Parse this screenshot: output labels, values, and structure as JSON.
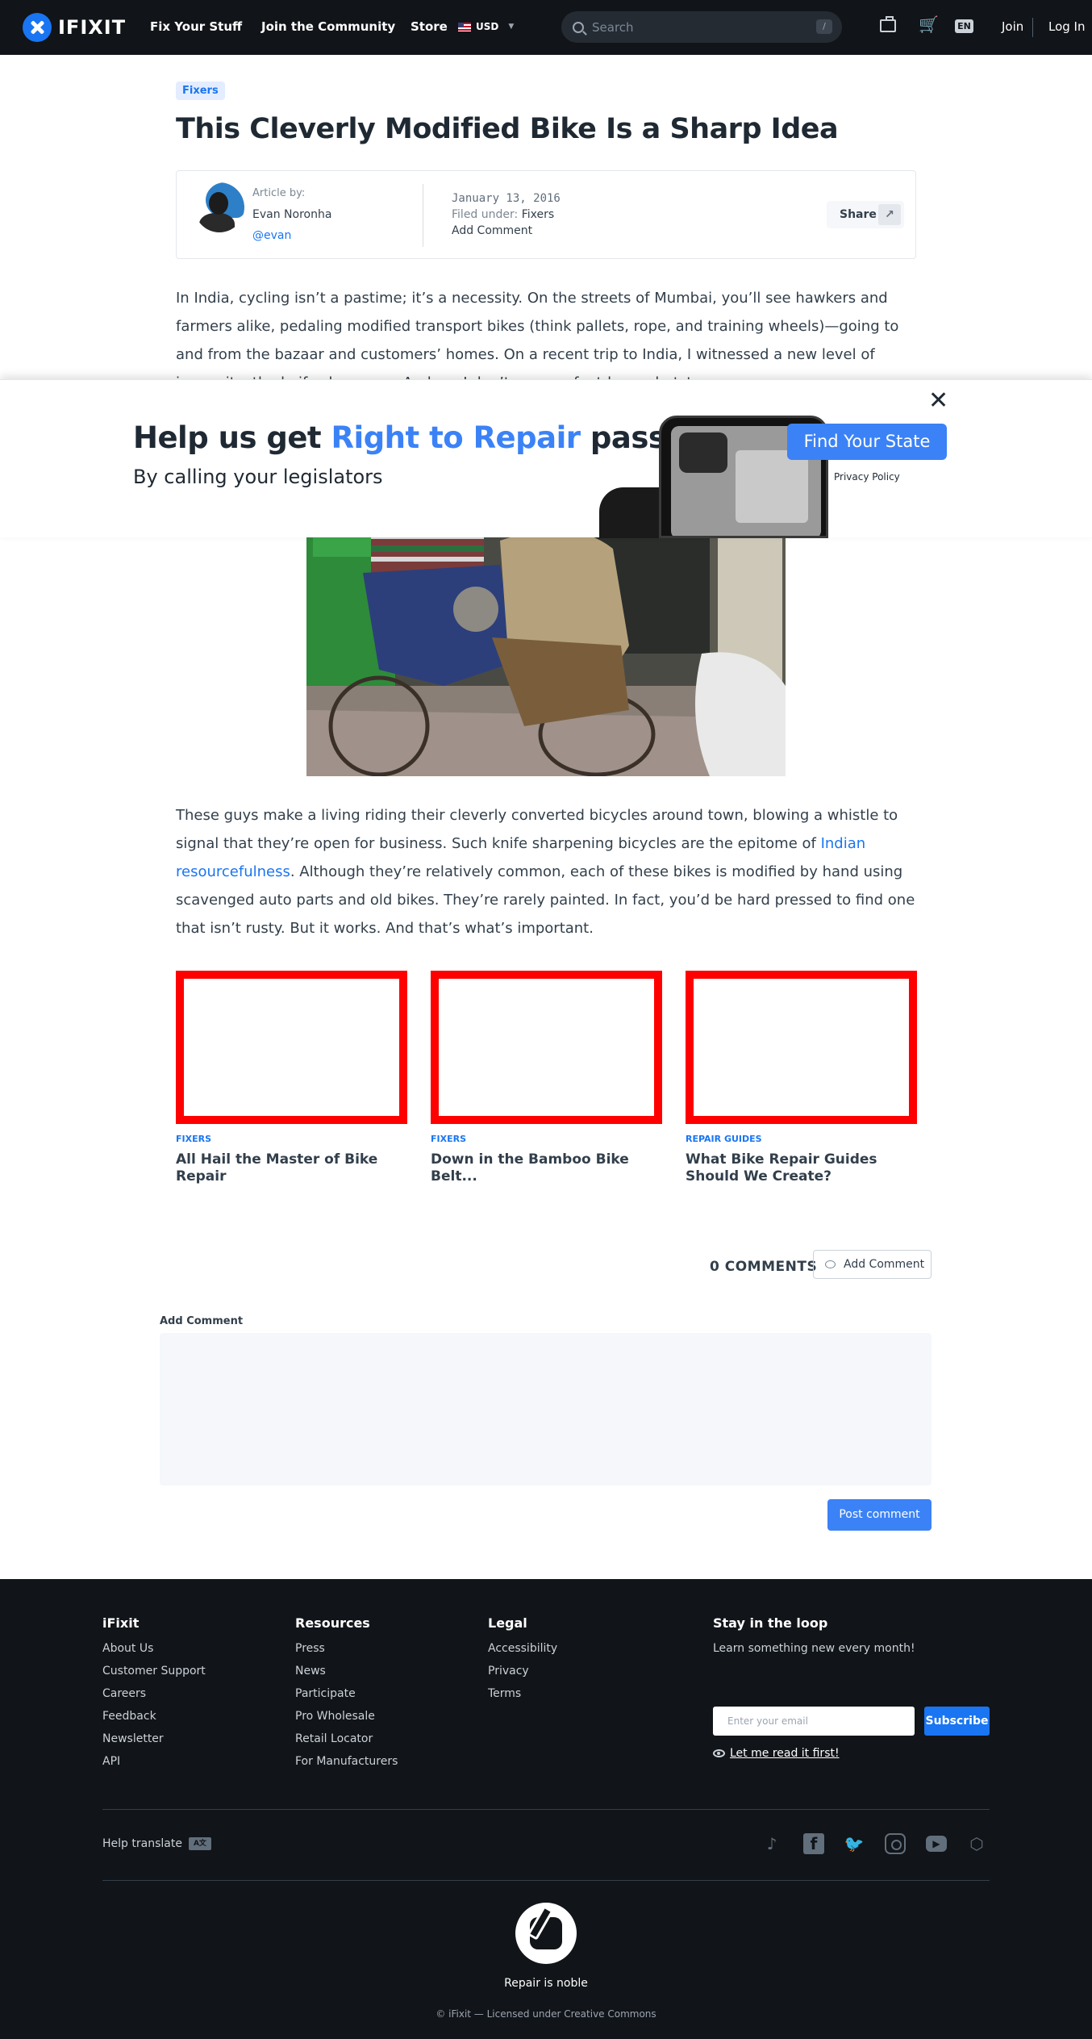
{
  "nav": {
    "logo": "IFIXIT",
    "links": [
      "Fix Your Stuff",
      "Join the Community",
      "Store"
    ],
    "currency": "USD",
    "search_placeholder": "Search",
    "search_shortcut": "/",
    "lang": "EN",
    "join": "Join",
    "login": "Log In"
  },
  "article": {
    "tag": "Fixers",
    "title": "This Cleverly Modified Bike Is a Sharp Idea",
    "article_by_label": "Article by:",
    "author": "Evan Noronha",
    "handle": "@evan",
    "date": "January 13, 2016",
    "filed_label": "Filed under:",
    "filed_value": "Fixers",
    "add_comment": "Add Comment",
    "share": "Share",
    "p1": "In India, cycling isn’t a pastime; it’s a necessity. On the streets of Mumbai, you’ll see hawkers and farmers alike, pedaling modified transport bikes (think pallets, rope, and training wheels)—going to and from the bazaar and customers’ homes. On a recent trip to India, I witnessed a new level of ingenuity: the knife sharpener. And no, I don’t mean a foot-long whetstone.",
    "p2_before": "These guys make a living riding their cleverly converted bicycles around town, blowing a whistle to signal that they’re open for business. Such knife sharpening bicycles are the epitome of ",
    "p2_link": "Indian resourcefulness",
    "p2_after": ". Although they’re relatively common, each of these bikes is modified by hand using scavenged auto parts and old bikes. They’re rarely painted. In fact, you’d be hard pressed to find one that isn’t rusty. But it works. And that’s what’s important."
  },
  "modal": {
    "close": "✕",
    "title_before": "Help us get ",
    "title_highlight": "Right to Repair",
    "title_after": " passed",
    "subtitle": "By calling your legislators",
    "cta": "Find Your State",
    "privacy": "Privacy Policy"
  },
  "related": [
    {
      "category": "FIXERS",
      "title": "All Hail the Master of Bike Repair"
    },
    {
      "category": "FIXERS",
      "title": "Down in the Bamboo Bike Belt..."
    },
    {
      "category": "REPAIR GUIDES",
      "title": "What Bike Repair Guides Should We Create?"
    }
  ],
  "comments": {
    "count": "0 COMMENTS",
    "add_button": "Add Comment",
    "label": "Add Comment",
    "post": "Post comment"
  },
  "footer": {
    "col1": {
      "title": "iFixit",
      "items": [
        "About Us",
        "Customer Support",
        "Careers",
        "Feedback",
        "Newsletter",
        "API"
      ]
    },
    "col2": {
      "title": "Resources",
      "items": [
        "Press",
        "News",
        "Participate",
        "Pro Wholesale",
        "Retail Locator",
        "For Manufacturers"
      ]
    },
    "col3": {
      "title": "Legal",
      "items": [
        "Accessibility",
        "Privacy",
        "Terms"
      ]
    },
    "loop": {
      "title": "Stay in the loop",
      "subtitle": "Learn something new every month!",
      "email_placeholder": "Enter your email",
      "subscribe": "Subscribe",
      "read": "Let me read it first!"
    },
    "help_translate": "Help translate",
    "noble": "Repair is noble",
    "copyright": "© iFixit — Licensed under Creative Commons"
  }
}
